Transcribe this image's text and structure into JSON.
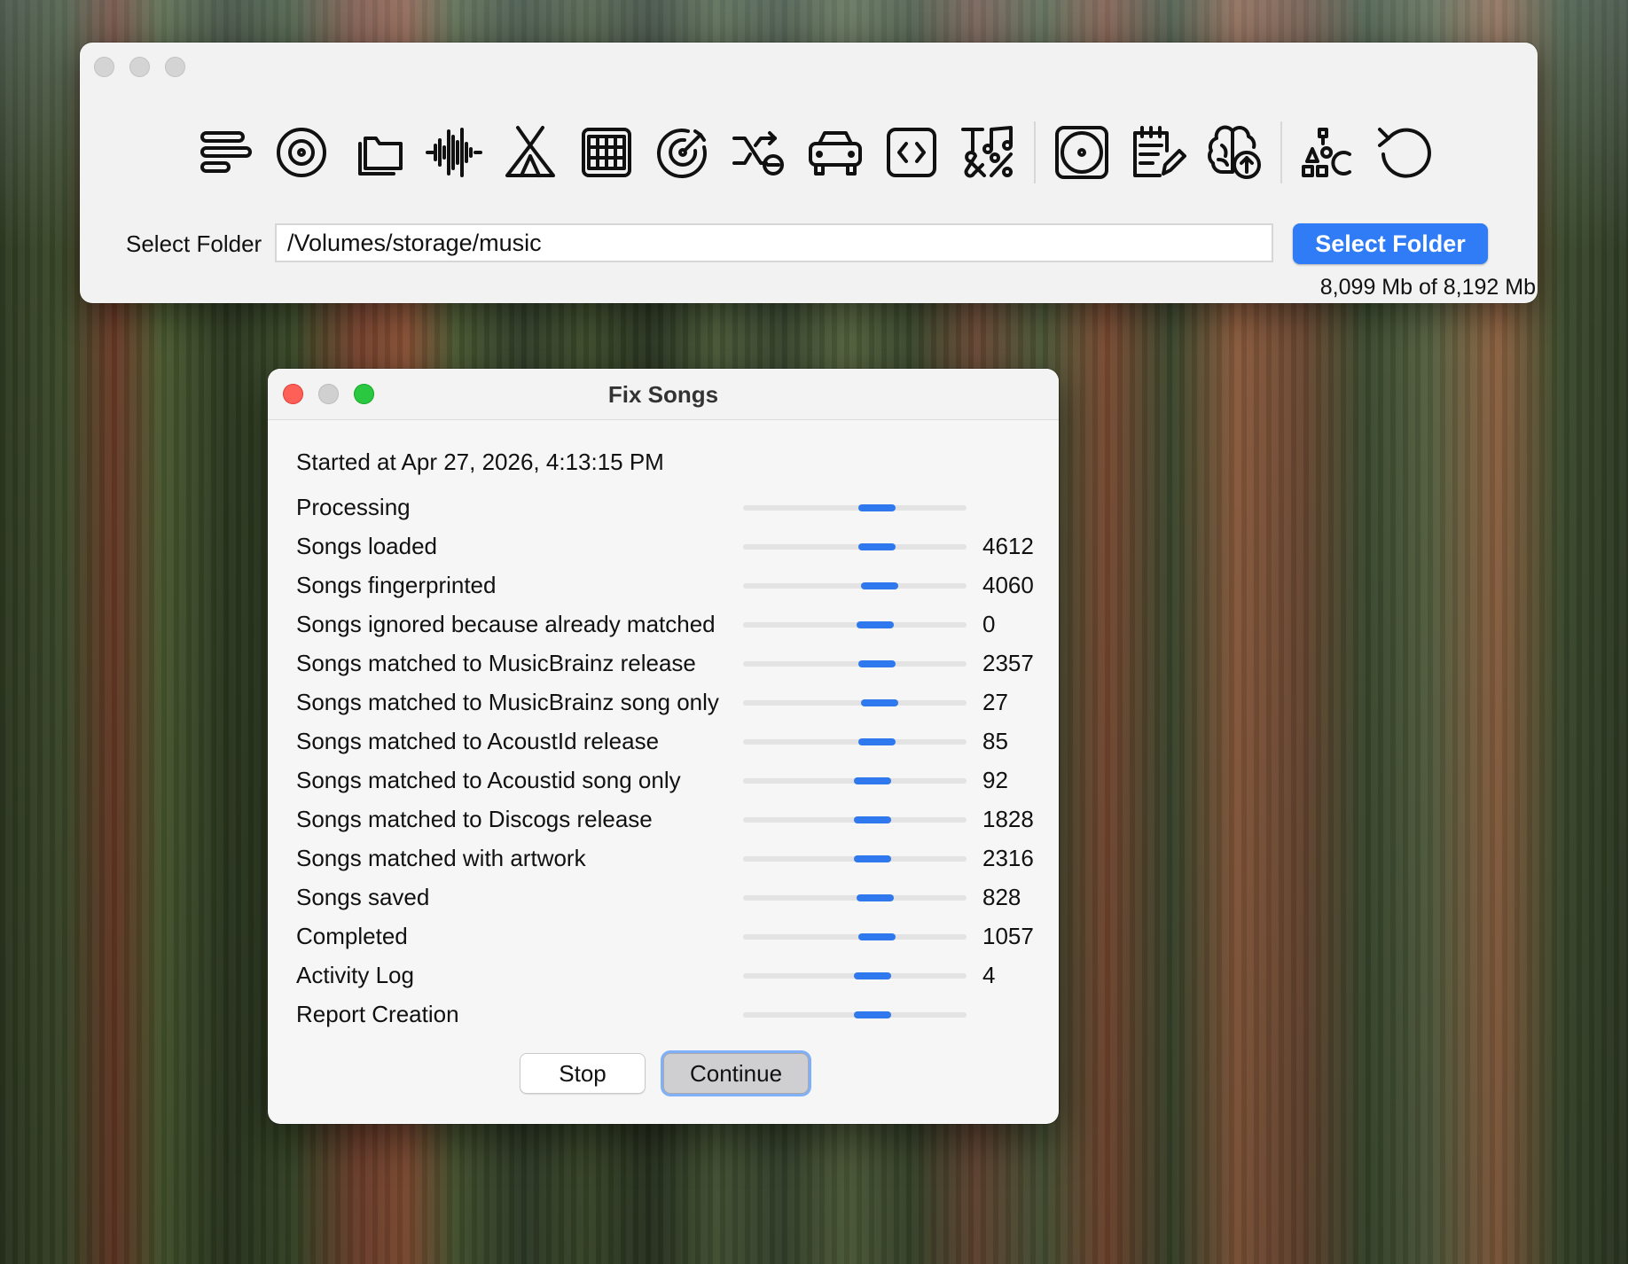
{
  "main_window": {
    "toolbar": [
      {
        "icon": "text-lines-icon"
      },
      {
        "icon": "target-circle-icon"
      },
      {
        "icon": "folders-icon"
      },
      {
        "icon": "waveform-icon"
      },
      {
        "icon": "tent-icon"
      },
      {
        "icon": "grid-icon"
      },
      {
        "icon": "dartboard-icon"
      },
      {
        "icon": "shuffle-minus-icon"
      },
      {
        "icon": "car-icon"
      },
      {
        "icon": "code-brackets-icon"
      },
      {
        "icon": "symbols-icon"
      },
      {
        "icon": "disc-icon"
      },
      {
        "icon": "edit-list-icon"
      },
      {
        "icon": "brain-upload-icon"
      },
      {
        "icon": "shapes-icon"
      },
      {
        "icon": "undo-icon"
      }
    ],
    "folder_label": "Select Folder",
    "folder_value": "/Volumes/storage/music",
    "select_button": "Select Folder",
    "storage_text": "8,099 Mb of 8,192 Mb"
  },
  "dialog": {
    "title": "Fix Songs",
    "started": "Started at Apr 27, 2026, 4:13:15 PM",
    "rows": [
      {
        "label": "Processing",
        "count": "",
        "progress": 0.6
      },
      {
        "label": "Songs loaded",
        "count": "4612",
        "progress": 0.6
      },
      {
        "label": "Songs fingerprinted",
        "count": "4060",
        "progress": 0.61
      },
      {
        "label": "Songs ignored because already matched",
        "count": "0",
        "progress": 0.59
      },
      {
        "label": "Songs matched to MusicBrainz release",
        "count": "2357",
        "progress": 0.6
      },
      {
        "label": "Songs matched to MusicBrainz song only",
        "count": "27",
        "progress": 0.61
      },
      {
        "label": "Songs matched to AcoustId release",
        "count": "85",
        "progress": 0.6
      },
      {
        "label": "Songs matched to Acoustid song only",
        "count": "92",
        "progress": 0.58
      },
      {
        "label": "Songs matched to Discogs release",
        "count": "1828",
        "progress": 0.58
      },
      {
        "label": "Songs matched with artwork",
        "count": "2316",
        "progress": 0.58
      },
      {
        "label": "Songs saved",
        "count": "828",
        "progress": 0.59
      },
      {
        "label": "Completed",
        "count": "1057",
        "progress": 0.6
      },
      {
        "label": "Activity Log",
        "count": "4",
        "progress": 0.58
      },
      {
        "label": "Report Creation",
        "count": "",
        "progress": 0.58
      }
    ],
    "stop_button": "Stop",
    "continue_button": "Continue"
  },
  "colors": {
    "accent": "#2f7cf6",
    "progress": "#2f78ee",
    "close": "#fe5f57",
    "zoom": "#2ac840"
  }
}
